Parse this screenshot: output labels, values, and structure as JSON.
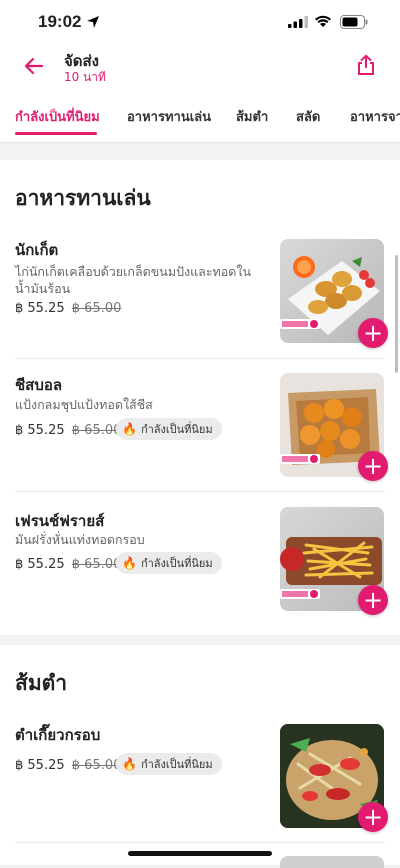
{
  "status_bar": {
    "time": "19:02"
  },
  "header": {
    "title": "จัดส่ง",
    "subtitle": "10 นาที"
  },
  "tabs": [
    {
      "label": "กำลังเป็นที่นิยม",
      "active": true
    },
    {
      "label": "อาหารทานเล่น",
      "active": false
    },
    {
      "label": "ส้มตำ",
      "active": false
    },
    {
      "label": "สลัด",
      "active": false
    },
    {
      "label": "อาหารจาน",
      "active": false
    }
  ],
  "sections": [
    {
      "title": "อาหารทานเล่น",
      "items": [
        {
          "name": "นักเก็ต",
          "description": "ไก่นักเก็ตเคลือบด้วยเกล็ดขนมปังและทอดในน้ำมันร้อน",
          "price": "฿ 55.25",
          "old_price": "฿ 65.00"
        },
        {
          "name": "ชีสบอล",
          "description": "แป้งกลมชุปแป้งทอดใส้ชีส",
          "price": "฿ 55.25",
          "old_price": "฿ 65.00",
          "badge": "กำลังเป็นที่นิยม"
        },
        {
          "name": "เฟรนช์ฟรายส์",
          "description": "มันฝรั่งหั่นแท่งทอดกรอบ",
          "price": "฿ 55.25",
          "old_price": "฿ 65.00",
          "badge": "กำลังเป็นที่นิยม"
        }
      ]
    },
    {
      "title": "ส้มตำ",
      "items": [
        {
          "name": "ตำเกี๊ยวกรอบ",
          "price": "฿ 55.25",
          "old_price": "฿ 65.00",
          "badge": "กำลังเป็นที่นิยม"
        }
      ]
    }
  ],
  "colors": {
    "brand": "#e21b70"
  }
}
